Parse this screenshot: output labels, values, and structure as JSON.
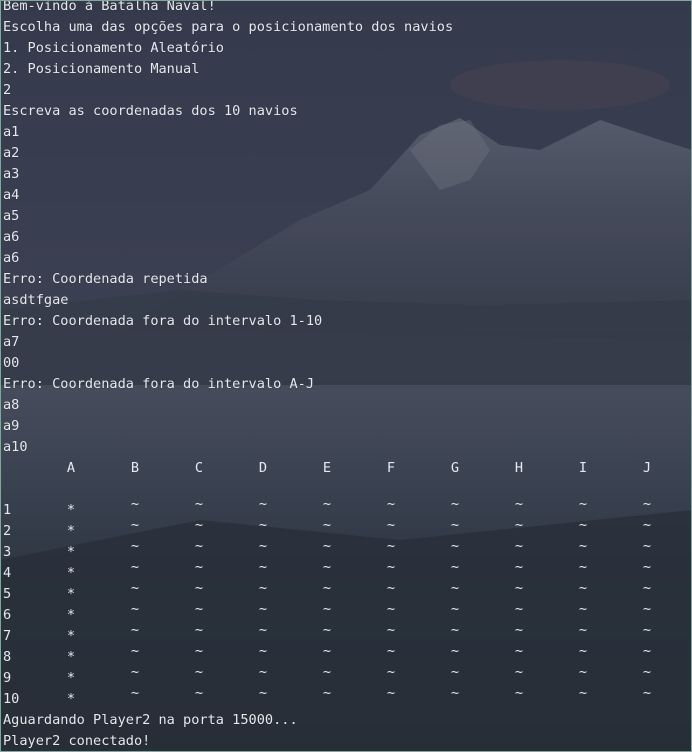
{
  "terminal": {
    "lines": [
      "Bem-vindo à Batalha Naval!",
      "Escolha uma das opções para o posicionamento dos navios",
      "1. Posicionamento Aleatório",
      "2. Posicionamento Manual",
      "2",
      "Escreva as coordenadas dos 10 navios",
      "a1",
      "a2",
      "a3",
      "a4",
      "a5",
      "a6",
      "a6",
      "Erro: Coordenada repetida",
      "asdtfgae",
      "Erro: Coordenada fora do intervalo 1-10",
      "a7",
      "00",
      "Erro: Coordenada fora do intervalo A-J",
      "a8",
      "a9",
      "a10"
    ],
    "footer_lines": [
      "Aguardando Player2 na porta 15000...",
      "Player2 conectado!"
    ]
  },
  "board": {
    "columns": [
      "A",
      "B",
      "C",
      "D",
      "E",
      "F",
      "G",
      "H",
      "I",
      "J"
    ],
    "rows": [
      {
        "label": "1",
        "cells": [
          "*",
          "~",
          "~",
          "~",
          "~",
          "~",
          "~",
          "~",
          "~",
          "~"
        ]
      },
      {
        "label": "2",
        "cells": [
          "*",
          "~",
          "~",
          "~",
          "~",
          "~",
          "~",
          "~",
          "~",
          "~"
        ]
      },
      {
        "label": "3",
        "cells": [
          "*",
          "~",
          "~",
          "~",
          "~",
          "~",
          "~",
          "~",
          "~",
          "~"
        ]
      },
      {
        "label": "4",
        "cells": [
          "*",
          "~",
          "~",
          "~",
          "~",
          "~",
          "~",
          "~",
          "~",
          "~"
        ]
      },
      {
        "label": "5",
        "cells": [
          "*",
          "~",
          "~",
          "~",
          "~",
          "~",
          "~",
          "~",
          "~",
          "~"
        ]
      },
      {
        "label": "6",
        "cells": [
          "*",
          "~",
          "~",
          "~",
          "~",
          "~",
          "~",
          "~",
          "~",
          "~"
        ]
      },
      {
        "label": "7",
        "cells": [
          "*",
          "~",
          "~",
          "~",
          "~",
          "~",
          "~",
          "~",
          "~",
          "~"
        ]
      },
      {
        "label": "8",
        "cells": [
          "*",
          "~",
          "~",
          "~",
          "~",
          "~",
          "~",
          "~",
          "~",
          "~"
        ]
      },
      {
        "label": "9",
        "cells": [
          "*",
          "~",
          "~",
          "~",
          "~",
          "~",
          "~",
          "~",
          "~",
          "~"
        ]
      },
      {
        "label": "10",
        "cells": [
          "*",
          "~",
          "~",
          "~",
          "~",
          "~",
          "~",
          "~",
          "~",
          "~"
        ]
      }
    ]
  },
  "colors": {
    "text": "#e6e9ee",
    "border": "#7fa79a"
  }
}
